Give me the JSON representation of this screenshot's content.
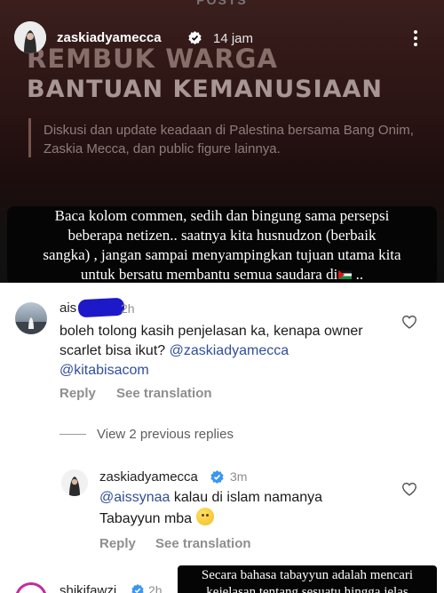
{
  "story": {
    "top_text": "POSTS",
    "headline_line1": "REMBUK WARGA",
    "headline_line2": "BANTUAN KEMANUSIAAN",
    "subtitle": "Diskusi dan update keadaan di Palestina bersama Bang Onim, Zaskia Mecca, dan public figure lainnya."
  },
  "header": {
    "username": "zaskiadyamecca",
    "time": "14 jam",
    "verified_icon": "verified-badge-icon",
    "more_icon": "more-vertical-icon"
  },
  "caption": {
    "line1": "Baca kolom commen, sedih dan bingung sama persepsi",
    "line2": "beberapa netizen.. saatnya kita husnudzon (berbaik",
    "line3": "sangka) , jangan sampai menyampingkan tujuan utama kita",
    "line4": "untuk bersatu membantu semua saudara di",
    "line4_end": " ..",
    "flag_icon": "palestine-flag-icon"
  },
  "comments": [
    {
      "username": "ais",
      "time": "2h",
      "text": "boleh tolong kasih penjelasan ka, kenapa owner scarlet bisa ikut? ",
      "mention1": "@zaskiadyamecca",
      "mention2": "@kitabisacom",
      "reply_label": "Reply",
      "translate_label": "See translation"
    }
  ],
  "view_replies": "View 2 previous replies",
  "reply": {
    "username": "zaskiadyamecca",
    "time": "3m",
    "mention": "@aissynaa",
    "text": " kalau di islam namanya Tabayyun mba ",
    "emoji_icon": "hugging-face-emoji-icon",
    "reply_label": "Reply",
    "translate_label": "See translation"
  },
  "bottom_comment": {
    "username": "shikifawzi",
    "time": "2h"
  },
  "bottom_caption": {
    "line1": "Secara bahasa tabayyun adalah mencari",
    "line2": "kejelasan tentang sesuatu hingga jelas"
  },
  "colors": {
    "mention": "#324e9a",
    "verified": "#3897f0",
    "secondary_text": "#8e8e8e",
    "redaction": "#1d19c9"
  }
}
